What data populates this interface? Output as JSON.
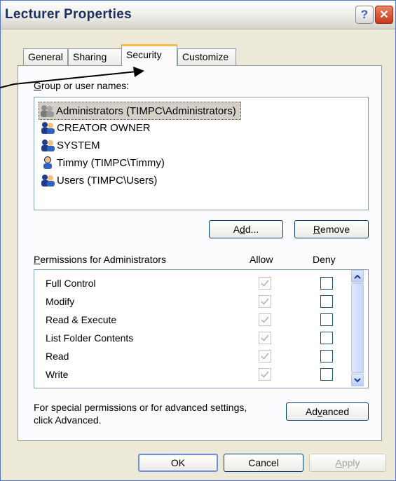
{
  "window": {
    "title": "Lecturer Properties"
  },
  "titlebar": {
    "help_label": "?",
    "close_label": "✕"
  },
  "tabs": [
    {
      "label": "General"
    },
    {
      "label": "Sharing"
    },
    {
      "label": "Security",
      "active": true
    },
    {
      "label": "Customize"
    }
  ],
  "groups": {
    "label_first": "G",
    "label_rest": "roup or user names:",
    "items": [
      {
        "name": "Administrators (TIMPC\\Administrators)",
        "selected": true,
        "icon": "group-icon"
      },
      {
        "name": "CREATOR OWNER",
        "icon": "group-icon"
      },
      {
        "name": "SYSTEM",
        "icon": "group-icon"
      },
      {
        "name": "Timmy (TIMPC\\Timmy)",
        "icon": "user-icon"
      },
      {
        "name": "Users (TIMPC\\Users)",
        "icon": "group-icon"
      }
    ]
  },
  "buttons": {
    "add_a": "A",
    "add_d": "d",
    "add_rest": "d...",
    "remove_r": "R",
    "remove_rest": "emove",
    "advanced_pre": "Ad",
    "advanced_v": "v",
    "advanced_rest": "anced",
    "ok": "OK",
    "cancel": "Cancel",
    "apply_a": "A",
    "apply_rest": "pply"
  },
  "permissions": {
    "label_first": "P",
    "label_rest": "ermissions for Administrators",
    "allow_header": "Allow",
    "deny_header": "Deny",
    "rows": [
      {
        "name": "Full Control",
        "allow": true,
        "deny": false
      },
      {
        "name": "Modify",
        "allow": true,
        "deny": false
      },
      {
        "name": "Read & Execute",
        "allow": true,
        "deny": false
      },
      {
        "name": "List Folder Contents",
        "allow": true,
        "deny": false
      },
      {
        "name": "Read",
        "allow": true,
        "deny": false
      },
      {
        "name": "Write",
        "allow": true,
        "deny": false
      }
    ]
  },
  "advanced_text_1": "For special permissions or for advanced settings,",
  "advanced_text_2": "click Advanced.",
  "colors": {
    "accent_tab": "#f7ba44",
    "border": "#7f9db9",
    "face": "#ece9d8"
  }
}
